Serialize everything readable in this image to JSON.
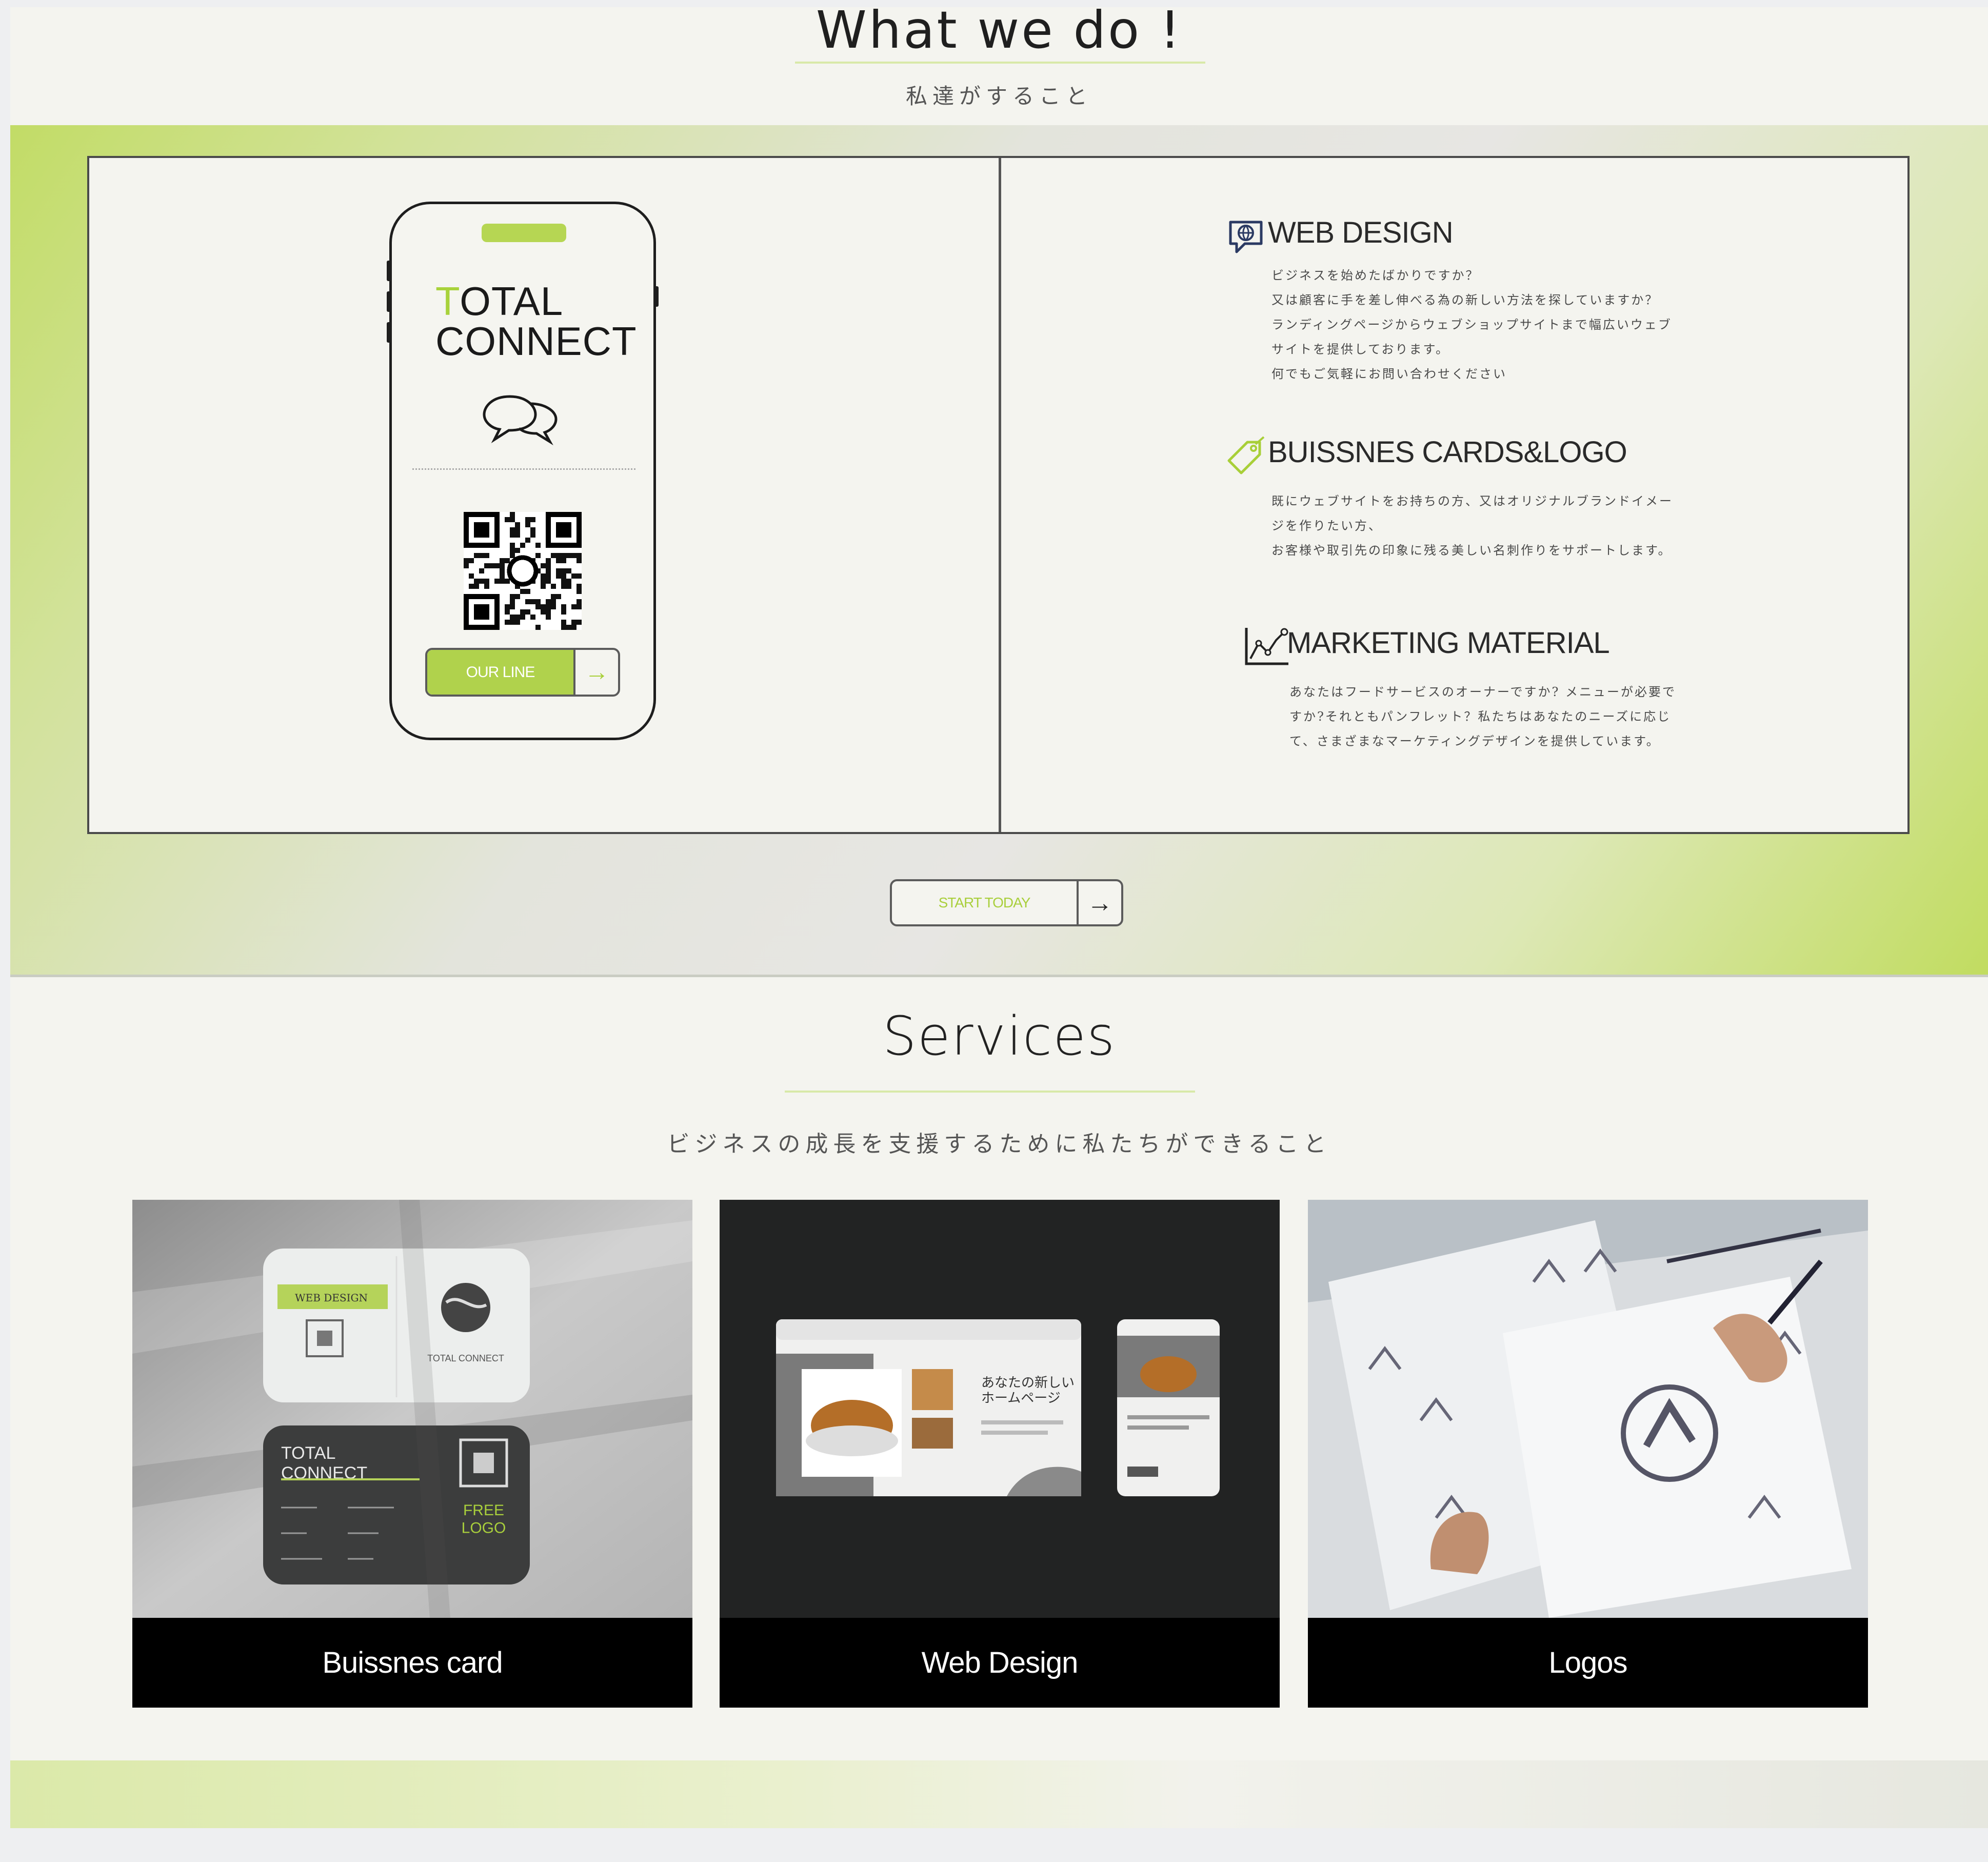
{
  "what_we_do": {
    "title": "What we do !",
    "subtitle": "私達がすること"
  },
  "phone": {
    "brand_first_letter": "T",
    "brand_rest_line1": "OTAL",
    "brand_line2": "CONNECT",
    "line_button": "OUR LINE",
    "arrow": "→"
  },
  "services_list": [
    {
      "title": "WEB DESIGN",
      "icon": "globe-chat-icon",
      "desc": "ビジネスを始めたばかりですか？\n又は顧客に手を差し伸べる為の新しい方法を探していますか？\nランディングページからウェブショップサイトまで幅広いウェブ\nサイトを提供しております。\n何でもご気軽にお問い合わせください"
    },
    {
      "title": "BUISSNES CARDS&LOGO",
      "icon": "tag-icon",
      "desc": "既にウェブサイトをお持ちの方、又はオリジナルブランドイメー\nジを作りたい方、\nお客様や取引先の印象に残る美しい名刺作りをサポートします。"
    },
    {
      "title": "MARKETING MATERIAL",
      "icon": "line-chart-icon",
      "desc": "あなたはフードサービスのオーナーですか? メニューが必要で\nすか?それともパンフレット？私たちはあなたのニーズに応じ\nて、さまざまなマーケティングデザインを提供しています。"
    }
  ],
  "start_button": {
    "label": "START TODAY",
    "arrow": "→"
  },
  "services": {
    "title": "Services",
    "subtitle": "ビジネスの成長を支援するために私たちができること",
    "tiles": [
      {
        "caption": "Buissnes card"
      },
      {
        "caption": "Web Design"
      },
      {
        "caption": "Logos"
      }
    ]
  },
  "image_text": {
    "card_tag": "WEB DESIGN",
    "card_brand": "TOTAL CONNECT",
    "card_dark_brand": "TOTAL\nCONNECT",
    "free_logo": "FREE\nLOGO",
    "web_headline": "あなたの新しい\nホームページ"
  },
  "colors": {
    "accent": "#b0d24c",
    "panel_bg": "#f4f4ef",
    "border": "#4a4a4a"
  }
}
